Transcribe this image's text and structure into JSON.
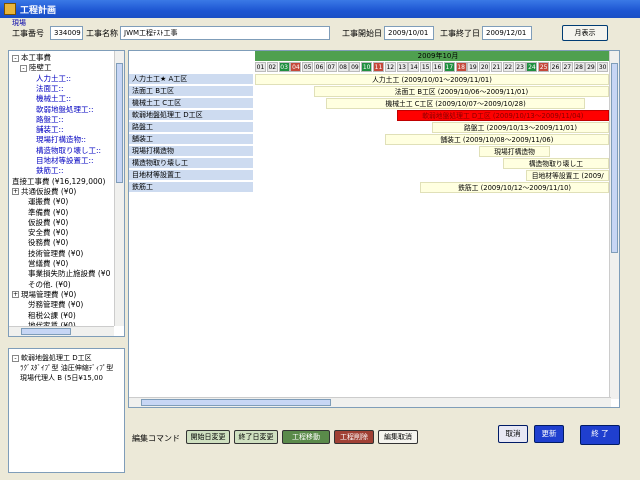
{
  "window": {
    "title": "工程計画",
    "sub_label": "現場"
  },
  "header": {
    "job_no_label": "工事番号",
    "job_no": "334009",
    "job_name_label": "工事名称",
    "job_name": "JWM工程ﾃｽﾄ工事",
    "start_label": "工事開始日",
    "start_date": "2009/10/01",
    "end_label": "工事終了日",
    "end_date": "2009/12/01",
    "month_button": "月表示"
  },
  "tree": {
    "rows": [
      {
        "t": "本工事費",
        "toggle": "-",
        "indent": 0,
        "blue": false
      },
      {
        "t": "陸壁工",
        "toggle": "-",
        "indent": 1,
        "blue": false
      },
      {
        "t": "人力土工::",
        "indent": 3,
        "blue": true
      },
      {
        "t": "法面工::",
        "indent": 3,
        "blue": true
      },
      {
        "t": "機械土工::",
        "indent": 3,
        "blue": true
      },
      {
        "t": "軟弱地盤処理工::",
        "indent": 3,
        "blue": true
      },
      {
        "t": "路盤工::",
        "indent": 3,
        "blue": true
      },
      {
        "t": "舗装工::",
        "indent": 3,
        "blue": true
      },
      {
        "t": "現場打構造物::",
        "indent": 3,
        "blue": true
      },
      {
        "t": "構造物取り壊し工::",
        "indent": 3,
        "blue": true
      },
      {
        "t": "目地材等設置工::",
        "indent": 3,
        "blue": true
      },
      {
        "t": "鉄筋工::",
        "indent": 3,
        "blue": true
      },
      {
        "t": "直接工事費 (¥16,129,000)",
        "indent": 0,
        "blue": false
      },
      {
        "t": "共通仮設費 (¥0)",
        "toggle": "+",
        "indent": 0,
        "blue": false
      },
      {
        "t": "運搬費 (¥0)",
        "indent": 2,
        "blue": false
      },
      {
        "t": "準備費 (¥0)",
        "indent": 2,
        "blue": false
      },
      {
        "t": "仮設費 (¥0)",
        "indent": 2,
        "blue": false
      },
      {
        "t": "安全費 (¥0)",
        "indent": 2,
        "blue": false
      },
      {
        "t": "役務費 (¥0)",
        "indent": 2,
        "blue": false
      },
      {
        "t": "技術管理費 (¥0)",
        "indent": 2,
        "blue": false
      },
      {
        "t": "営繕費 (¥0)",
        "indent": 2,
        "blue": false
      },
      {
        "t": "事業損失防止施設費 (¥0",
        "indent": 2,
        "blue": false
      },
      {
        "t": "その他. (¥0)",
        "indent": 2,
        "blue": false
      },
      {
        "t": "現場管理費 (¥0)",
        "toggle": "+",
        "indent": 0,
        "blue": false
      },
      {
        "t": "労務管理費 (¥0)",
        "indent": 2,
        "blue": false
      },
      {
        "t": "租税公課 (¥0)",
        "indent": 2,
        "blue": false
      },
      {
        "t": "地代家賃 (¥0)",
        "indent": 2,
        "blue": false
      }
    ]
  },
  "detail": {
    "rows": [
      {
        "t": "軟弱地盤処理工 D工区",
        "toggle": "-",
        "indent": 0
      },
      {
        "t": "ﾗｸﾞｽﾀﾞｲﾌﾟ型 油圧伸縮ﾃﾞｨﾌﾟ型",
        "indent": 1
      },
      {
        "t": "現場代理人 B (5日¥15,00",
        "indent": 1
      }
    ]
  },
  "gantt": {
    "month": "2009年10月",
    "days": [
      {
        "d": "01",
        "c": ""
      },
      {
        "d": "02",
        "c": ""
      },
      {
        "d": "03",
        "c": "green"
      },
      {
        "d": "04",
        "c": "red"
      },
      {
        "d": "05",
        "c": ""
      },
      {
        "d": "06",
        "c": ""
      },
      {
        "d": "07",
        "c": ""
      },
      {
        "d": "08",
        "c": ""
      },
      {
        "d": "09",
        "c": ""
      },
      {
        "d": "10",
        "c": "green"
      },
      {
        "d": "11",
        "c": "red"
      },
      {
        "d": "12",
        "c": ""
      },
      {
        "d": "13",
        "c": ""
      },
      {
        "d": "14",
        "c": ""
      },
      {
        "d": "15",
        "c": ""
      },
      {
        "d": "16",
        "c": ""
      },
      {
        "d": "17",
        "c": "green"
      },
      {
        "d": "18",
        "c": "red"
      },
      {
        "d": "19",
        "c": ""
      },
      {
        "d": "20",
        "c": ""
      },
      {
        "d": "21",
        "c": ""
      },
      {
        "d": "22",
        "c": ""
      },
      {
        "d": "23",
        "c": ""
      },
      {
        "d": "24",
        "c": "green"
      },
      {
        "d": "25",
        "c": "red"
      },
      {
        "d": "26",
        "c": ""
      },
      {
        "d": "27",
        "c": ""
      },
      {
        "d": "28",
        "c": ""
      },
      {
        "d": "29",
        "c": ""
      },
      {
        "d": "30",
        "c": ""
      },
      {
        "d": "31",
        "c": "green"
      }
    ],
    "tasks": [
      {
        "name": "人力土工★ A工区",
        "bar": "人力土工 (2009/10/01～2009/11/01)",
        "s": 1,
        "e": 33,
        "red": false
      },
      {
        "name": "法面工 B工区",
        "bar": "法面工 B工区 (2009/10/06～2009/11/01)",
        "s": 6,
        "e": 33,
        "red": false
      },
      {
        "name": "機械土工 C工区",
        "bar": "機械土工 C工区 (2009/10/07～2009/10/28)",
        "s": 7,
        "e": 28,
        "red": false
      },
      {
        "name": "軟弱地盤処理工 D工区",
        "bar": "軟弱地盤処理工 D工区 (2009/10/13～2009/11/04)",
        "s": 13,
        "e": 33,
        "red": true
      },
      {
        "name": "路盤工",
        "bar": "路盤工 (2009/10/13～2009/11/01)",
        "s": 16,
        "e": 33,
        "red": false
      },
      {
        "name": "舗装工",
        "bar": "舗装工 (2009/10/08～2009/11/06)",
        "s": 12,
        "e": 33,
        "red": false
      },
      {
        "name": "現場打構造物",
        "bar": "現場打構造物",
        "s": 20,
        "e": 25,
        "red": false
      },
      {
        "name": "構造物取り壊し工",
        "bar": "構造物取り壊し工",
        "s": 22,
        "e": 33,
        "red": false
      },
      {
        "name": "目地材等設置工",
        "bar": "目地材等設置工 (2009/",
        "s": 24,
        "e": 33,
        "red": false
      },
      {
        "name": "鉄筋工",
        "bar": "鉄筋工 (2009/10/12～2009/11/10)",
        "s": 15,
        "e": 33,
        "red": false
      }
    ]
  },
  "commands": {
    "label": "編集コマンド",
    "start_change": "開始日変更",
    "end_change": "終了日変更",
    "move": "工程移動",
    "delete": "工程削除",
    "cancel_edit": "編集取消",
    "cancel": "取消",
    "update": "更新",
    "finish": "終 了"
  },
  "colors": {
    "titlebar": "#1d55d2",
    "weekday": "#1f8f3f",
    "holiday": "#c5483a",
    "highlight": "#ff0000"
  }
}
